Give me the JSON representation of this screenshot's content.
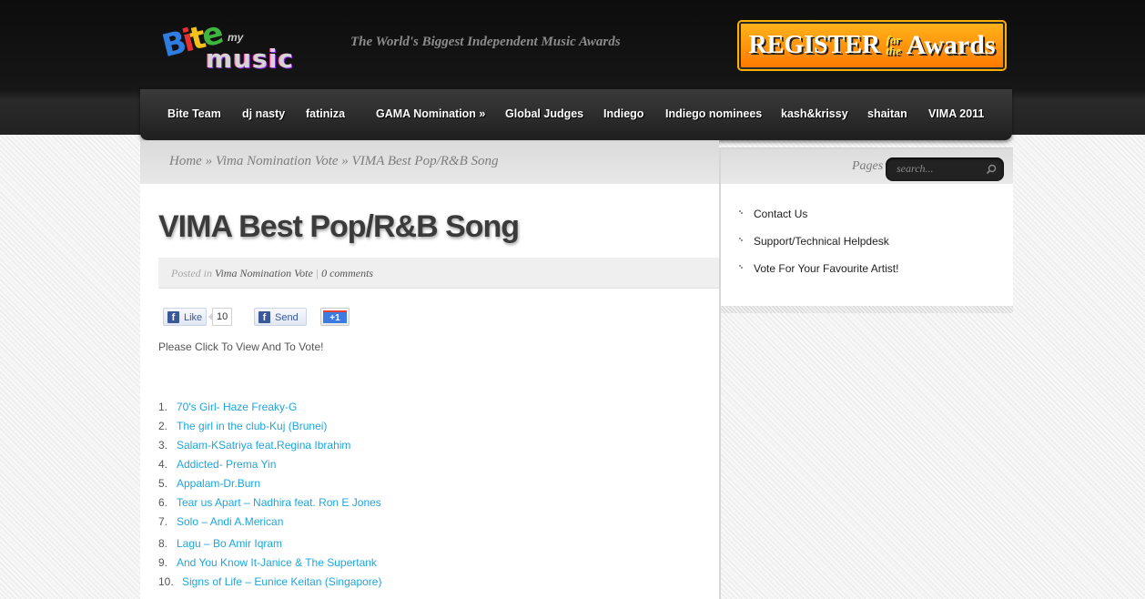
{
  "header": {
    "logo": {
      "bite": "Bite",
      "my": "my",
      "music": "music"
    },
    "tagline": "The World's Biggest Independent Music Awards",
    "register_button": {
      "register": "REGISTER",
      "for": "for",
      "the": "the",
      "awards": "Awards"
    }
  },
  "nav": {
    "items": [
      {
        "label": "Bite Team"
      },
      {
        "label": "dj nasty"
      },
      {
        "label": "fatiniza"
      },
      {
        "label": "GAMA Nomination »"
      },
      {
        "label": "Global Judges"
      },
      {
        "label": "Indiego"
      },
      {
        "label": "Indiego nominees"
      },
      {
        "label": "kash&krissy"
      },
      {
        "label": "shaitan"
      },
      {
        "label": "VIMA 2011"
      }
    ]
  },
  "breadcrumb": {
    "home": "Home",
    "sep1": " » ",
    "section": "Vima Nomination Vote",
    "sep2": " » ",
    "current": "VIMA Best Pop/R&B Song"
  },
  "search": {
    "label": "Pages",
    "placeholder": "search..."
  },
  "post": {
    "title": "VIMA Best Pop/R&B Song",
    "meta": {
      "posted_in": "Posted in",
      "category": "Vima Nomination Vote",
      "separator": "|",
      "comments": "0 comments"
    },
    "social": {
      "like_label": "Like",
      "like_count": "10",
      "send_label": "Send",
      "gplus_label": "+1"
    },
    "intro": "Please Click To View And To Vote!",
    "songs": [
      {
        "num": "1.",
        "title": "70's Girl- Haze Freaky-G"
      },
      {
        "num": "2.",
        "title": "The girl in the club-Kuj (Brunei)"
      },
      {
        "num": "3.",
        "title": "Salam-KSatriya feat.Regina Ibrahim"
      },
      {
        "num": "4.",
        "title": "Addicted- Prema Yin"
      },
      {
        "num": "5.",
        "title": "Appalam-Dr.Burn"
      },
      {
        "num": "6.",
        "title": "Tear us Apart – Nadhira feat. Ron E Jones"
      },
      {
        "num": "7.",
        "title": "Solo – Andi A.Merican"
      },
      {
        "num": "8.",
        "title": "Lagu – Bo Amir Iqram"
      },
      {
        "num": "9.",
        "title": "And You Know It-Janice & The Supertank"
      },
      {
        "num": "10.",
        "title": "Signs of Life – Eunice Keitan (Singapore)"
      }
    ]
  },
  "sidebar": {
    "pages": [
      {
        "label": "Contact Us"
      },
      {
        "label": "Support/Technical Helpdesk"
      },
      {
        "label": "Vote For Your Favourite Artist!"
      }
    ]
  },
  "colors": {
    "link": "#1ea5dc",
    "header_bg": "#111111",
    "register_orange": "#ff8c00"
  }
}
